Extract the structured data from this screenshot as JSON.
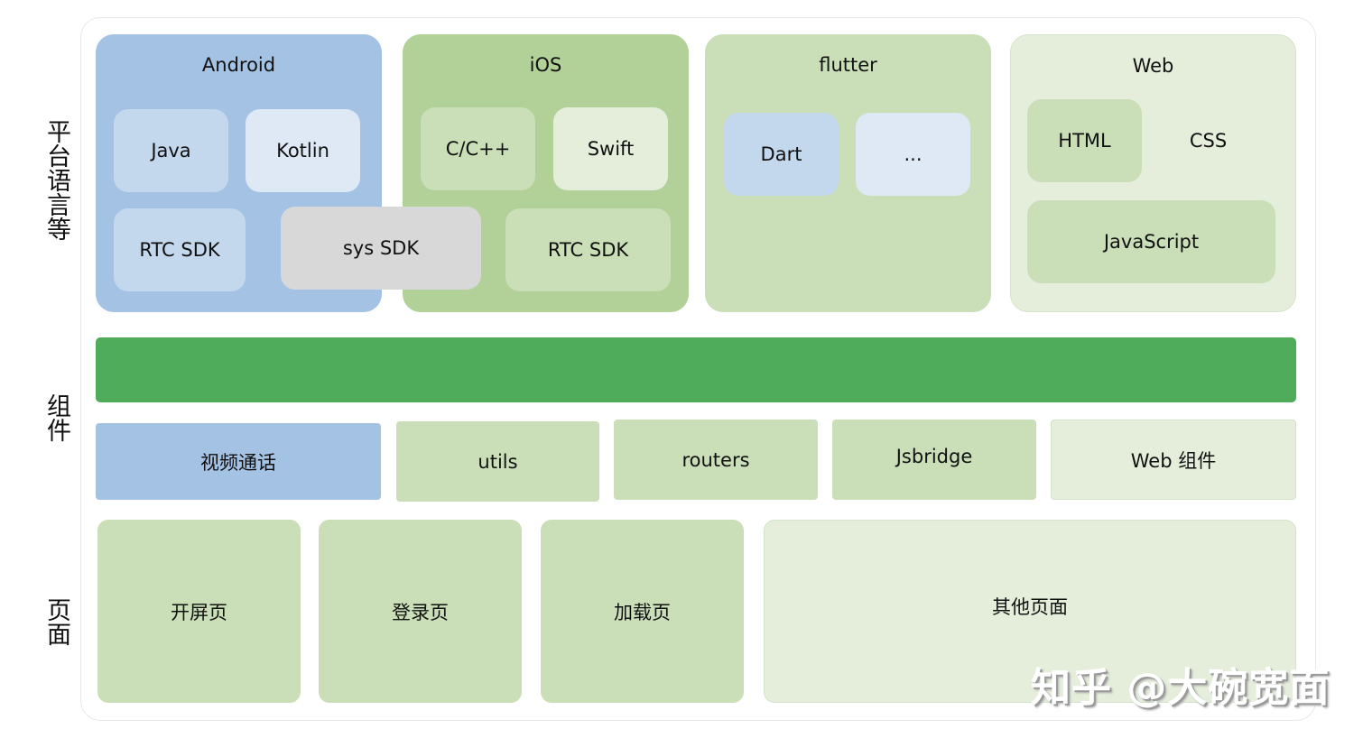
{
  "row_labels": {
    "platform": "平台语言等",
    "components": "组件",
    "pages": "页面"
  },
  "platforms": {
    "android": {
      "title": "Android",
      "items": [
        "Java",
        "Kotlin",
        "RTC SDK"
      ]
    },
    "ios": {
      "title": "iOS",
      "items": [
        "C/C++",
        "Swift",
        "RTC SDK"
      ]
    },
    "shared": {
      "sys_sdk": "sys SDK"
    },
    "flutter": {
      "title": "flutter",
      "items": [
        "Dart",
        "..."
      ]
    },
    "web": {
      "title": "Web",
      "items": [
        "HTML",
        "CSS",
        "JavaScript"
      ]
    }
  },
  "components": {
    "bar_label": "",
    "items": [
      "视频通话",
      "utils",
      "routers",
      "Jsbridge",
      "Web 组件"
    ]
  },
  "pages": {
    "items": [
      "开屏页",
      "登录页",
      "加载页",
      "其他页面"
    ]
  },
  "watermark": "知乎 @大碗宽面",
  "colors": {
    "android_blue": "#a4c2e4",
    "ios_green": "#b2d198",
    "flutter_green": "#cadfb8",
    "web_green": "#e4eedb",
    "component_bar": "#4fac5b",
    "sys_sdk_gray": "#d8d8d8"
  }
}
